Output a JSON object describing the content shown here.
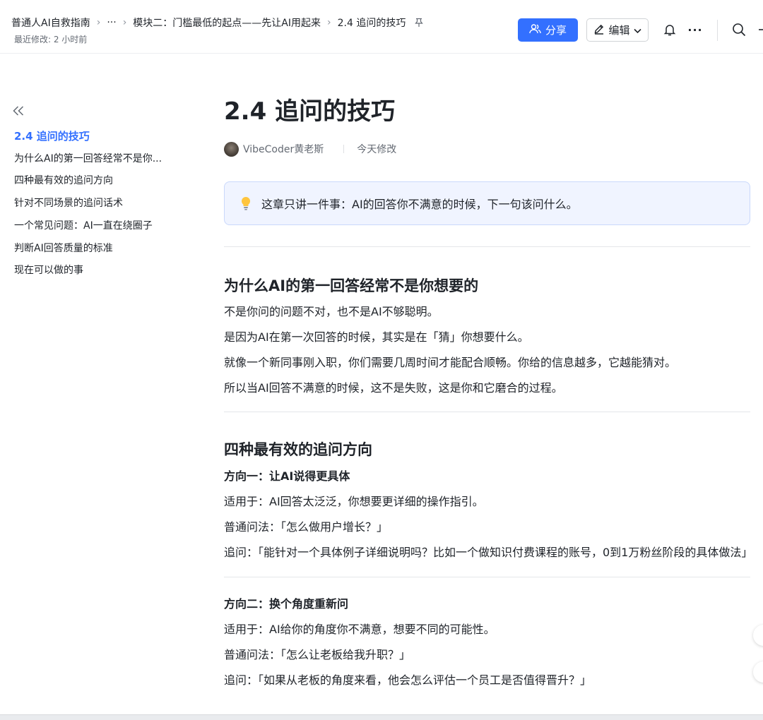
{
  "breadcrumb": {
    "root": "普通人AI自救指南",
    "more": "···",
    "module": "模块二：门槛最低的起点——先让AI用起来",
    "current": "2.4 追问的技巧"
  },
  "last_modified": "最近修改: 2 小时前",
  "toolbar": {
    "share_label": "分享",
    "edit_label": "编辑",
    "more_label": "···"
  },
  "outline": {
    "items": [
      {
        "label": "2.4 追问的技巧",
        "active": true
      },
      {
        "label": "为什么AI的第一回答经常不是你..."
      },
      {
        "label": "四种最有效的追问方向"
      },
      {
        "label": "针对不同场景的追问话术"
      },
      {
        "label": "一个常见问题：AI一直在绕圈子"
      },
      {
        "label": "判断AI回答质量的标准"
      },
      {
        "label": "现在可以做的事"
      }
    ]
  },
  "doc": {
    "title": "2.4 追问的技巧",
    "author": "VibeCoder黄老斯",
    "edited": "今天修改",
    "callout": "这章只讲一件事：AI的回答你不满意的时候，下一句该问什么。",
    "section1": {
      "heading": "为什么AI的第一回答经常不是你想要的",
      "paragraphs": [
        "不是你问的问题不对，也不是AI不够聪明。",
        "是因为AI在第一次回答的时候，其实是在「猜」你想要什么。",
        "就像一个新同事刚入职，你们需要几周时间才能配合顺畅。你给的信息越多，它越能猜对。",
        "所以当AI回答不满意的时候，这不是失败，这是你和它磨合的过程。"
      ]
    },
    "section2": {
      "heading": "四种最有效的追问方向",
      "direction1": {
        "title": "方向一：让AI说得更具体",
        "applies": "适用于：AI回答太泛泛，你想要更详细的操作指引。",
        "normal": "普通问法：「怎么做用户增长？」",
        "followup": "追问：「能针对一个具体例子详细说明吗？比如一个做知识付费课程的账号，0到1万粉丝阶段的具体做法」"
      },
      "direction2": {
        "title": "方向二：换个角度重新问",
        "applies": "适用于：AI给你的角度你不满意，想要不同的可能性。",
        "normal": "普通问法：「怎么让老板给我升职？」",
        "followup": "追问：「如果从老板的角度来看，他会怎么评估一个员工是否值得晋升？」"
      }
    }
  },
  "colors": {
    "accent": "#3370ff",
    "callout_bg": "#f0f4ff",
    "callout_border": "#c9d8fb"
  },
  "icons": [
    "chevron-right-icon",
    "pin-icon",
    "share-users-icon",
    "pencil-icon",
    "chevron-down-icon",
    "bell-icon",
    "more-icon",
    "search-icon",
    "collapse-icon",
    "lightbulb-icon"
  ]
}
